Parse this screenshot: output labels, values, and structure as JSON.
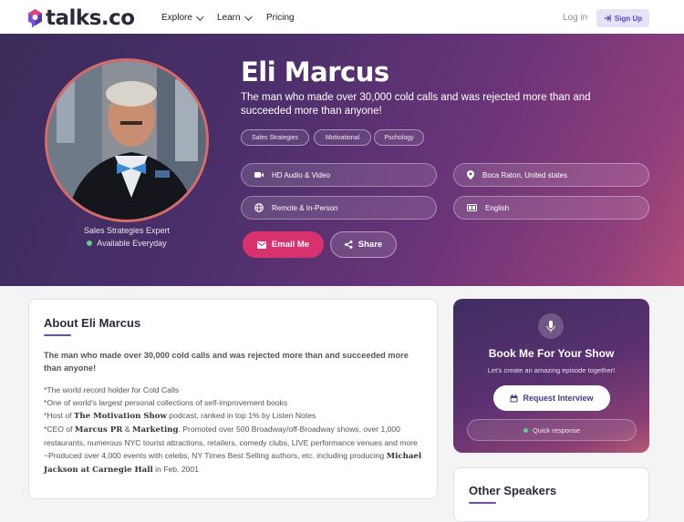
{
  "nav": {
    "logo": "talks.co",
    "links": [
      {
        "label": "Explore",
        "dropdown": true
      },
      {
        "label": "Learn",
        "dropdown": true
      },
      {
        "label": "Pricing",
        "dropdown": false
      }
    ],
    "login": "Log in",
    "signup": "Sign Up"
  },
  "profile": {
    "name": "Eli Marcus",
    "tagline": "The man who made over 30,000 cold calls and was rejected more than and succeeded more than anyone!",
    "title": "Sales Strategies Expert",
    "availability": "Available Everyday",
    "tags": [
      "Sales Strategies",
      "Motivational",
      "Pschology"
    ],
    "details": {
      "format": "HD Audio & Video",
      "location": "Boca Raton, United states",
      "mode": "Remote & In-Person",
      "language": "English"
    },
    "email_button": "Email Me",
    "share_button": "Share"
  },
  "about": {
    "heading": "About Eli Marcus",
    "lead": "The man who made over 30,000 cold calls and was rejected more than and succeeded more than anyone!",
    "line1": "*The world record holder for Cold Calls",
    "line2": "*One of world's largest personal collections of self-improvement books",
    "line3_pre": "*Host of ",
    "line3_bold": "The Motivation Show",
    "line3_post": " podcast, ranked in top 1% by Listen Notes",
    "line4_pre": "*CEO of ",
    "line4_bold1": "Marcus PR",
    "line4_mid": " & ",
    "line4_bold2": "Marketing",
    "line4_post": ". Promoted over 500 Broadway/off-Broadway shows, over 1,000 restaurants, numerous NYC tourist attractions, retailers, comedy clubs, LIVE performance venues and more",
    "line5_pre": "~Produced over 4,000 events with celebs, NY Times Best Selling authors, etc. including producing ",
    "line5_bold": "Michael Jackson at Carnegie Hall",
    "line5_post": " in Feb. 2001"
  },
  "booking": {
    "heading": "Book Me For Your Show",
    "subheading": "Let's create an amazing episode together!",
    "request_button": "Request Interview",
    "quick_response": "Quick response"
  },
  "other": {
    "heading": "Other Speakers"
  }
}
